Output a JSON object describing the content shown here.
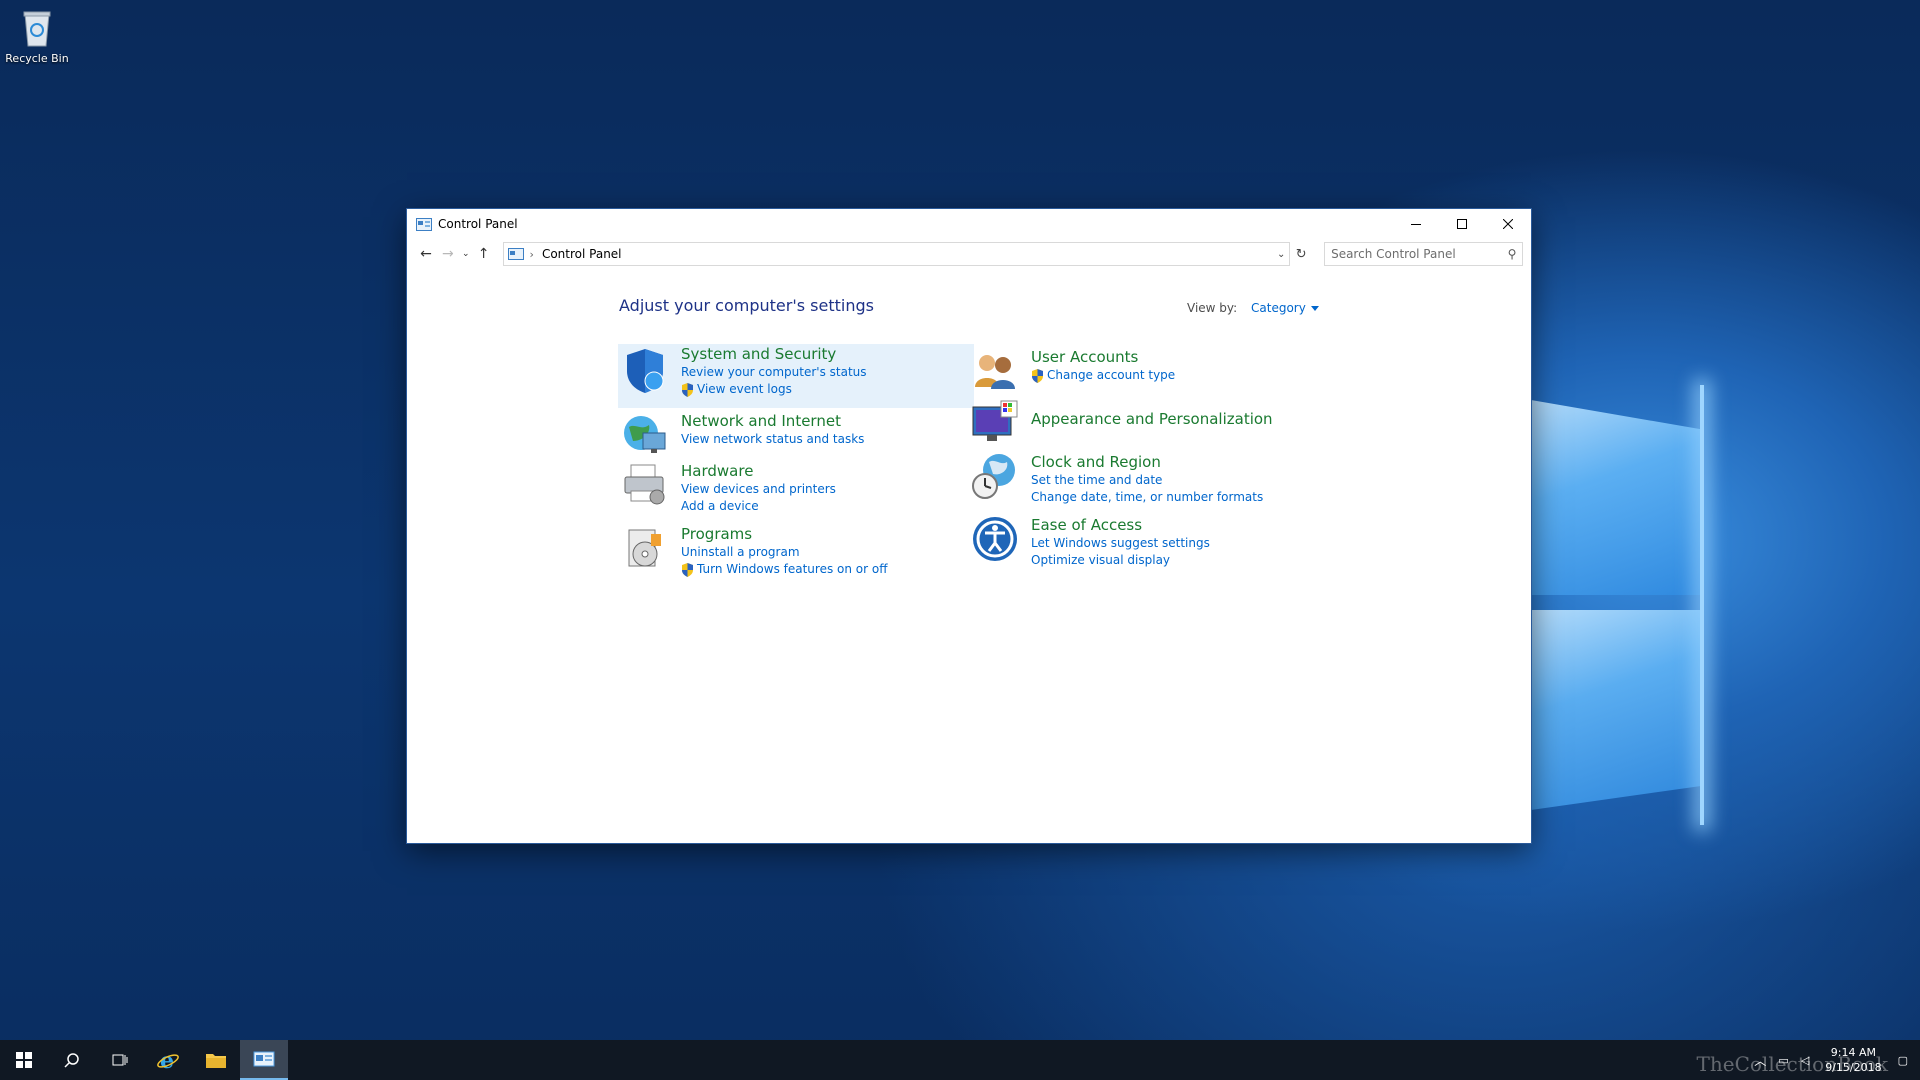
{
  "desktop": {
    "recycle_bin_label": "Recycle Bin"
  },
  "window": {
    "title": "Control Panel",
    "app_icon": "control-panel-icon",
    "controls": {
      "minimize": "minimize-icon",
      "maximize": "maximize-icon",
      "close": "close-icon"
    }
  },
  "nav": {
    "breadcrumb": "Control Panel",
    "search_placeholder": "Search Control Panel"
  },
  "main": {
    "heading": "Adjust your computer's settings",
    "view_by_label": "View by:",
    "view_by_value": "Category",
    "categories": [
      {
        "title": "System and Security",
        "links": [
          "Review your computer's status",
          "View event logs"
        ],
        "icon": "shield-icon"
      },
      {
        "title": "Network and Internet",
        "links": [
          "View network status and tasks"
        ],
        "icon": "globe-network-icon"
      },
      {
        "title": "Hardware",
        "links": [
          "View devices and printers",
          "Add a device"
        ],
        "icon": "printer-icon"
      },
      {
        "title": "Programs",
        "links": [
          "Uninstall a program",
          "Turn Windows features on or off"
        ],
        "icon": "programs-icon"
      },
      {
        "title": "User Accounts",
        "links": [
          "Change account type"
        ],
        "icon": "users-icon"
      },
      {
        "title": "Appearance and Personalization",
        "links": [],
        "icon": "monitor-palette-icon"
      },
      {
        "title": "Clock and Region",
        "links": [
          "Set the time and date",
          "Change date, time, or number formats"
        ],
        "icon": "clock-globe-icon"
      },
      {
        "title": "Ease of Access",
        "links": [
          "Let Windows suggest settings",
          "Optimize visual display"
        ],
        "icon": "ease-of-access-icon"
      }
    ]
  },
  "taskbar": {
    "time": "9:14 AM",
    "date": "9/15/2018",
    "watermark": "TheCollectionBook"
  },
  "colors": {
    "category_title": "#1a7a30",
    "link": "#0066cc",
    "heading": "#1e3287",
    "highlight": "#e5f1fb"
  }
}
